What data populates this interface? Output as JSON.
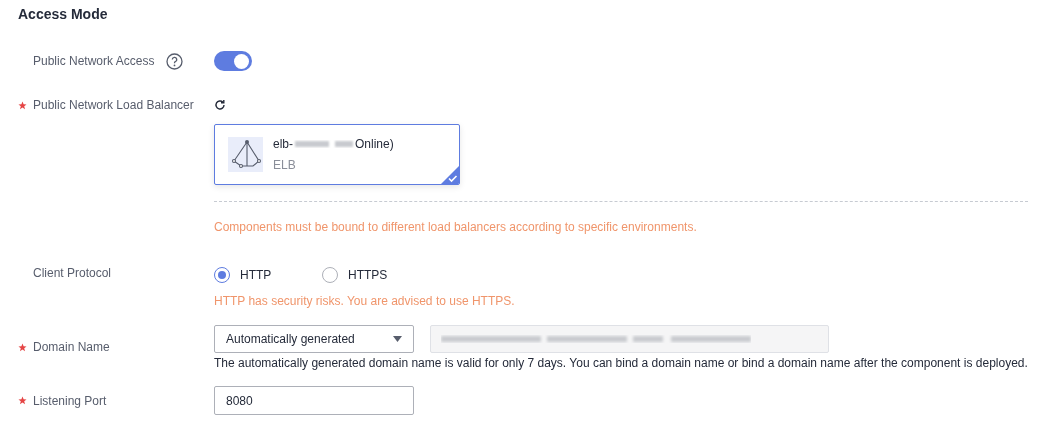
{
  "section_title": "Access Mode",
  "public_access": {
    "label": "Public Network Access",
    "required": false,
    "on": true
  },
  "load_balancer": {
    "label": "Public Network Load Balancer",
    "required": true,
    "cards": [
      {
        "name_prefix": "elb-",
        "name_suffix": "Online)",
        "type": "ELB",
        "selected": true
      }
    ],
    "hint": "Components must be bound to different load balancers according to specific environments."
  },
  "client_protocol": {
    "label": "Client Protocol",
    "required": false,
    "options": [
      {
        "label": "HTTP",
        "selected": true
      },
      {
        "label": "HTTPS",
        "selected": false
      }
    ],
    "warning": "HTTP has security risks. You are advised to use HTTPS."
  },
  "domain_name": {
    "label": "Domain Name",
    "required": true,
    "select_value": "Automatically generated",
    "description": "The automatically generated domain name is valid for only 7 days. You can bind a domain name or bind a domain name after the component is deployed."
  },
  "listening_port": {
    "label": "Listening Port",
    "required": true,
    "value": "8080"
  }
}
